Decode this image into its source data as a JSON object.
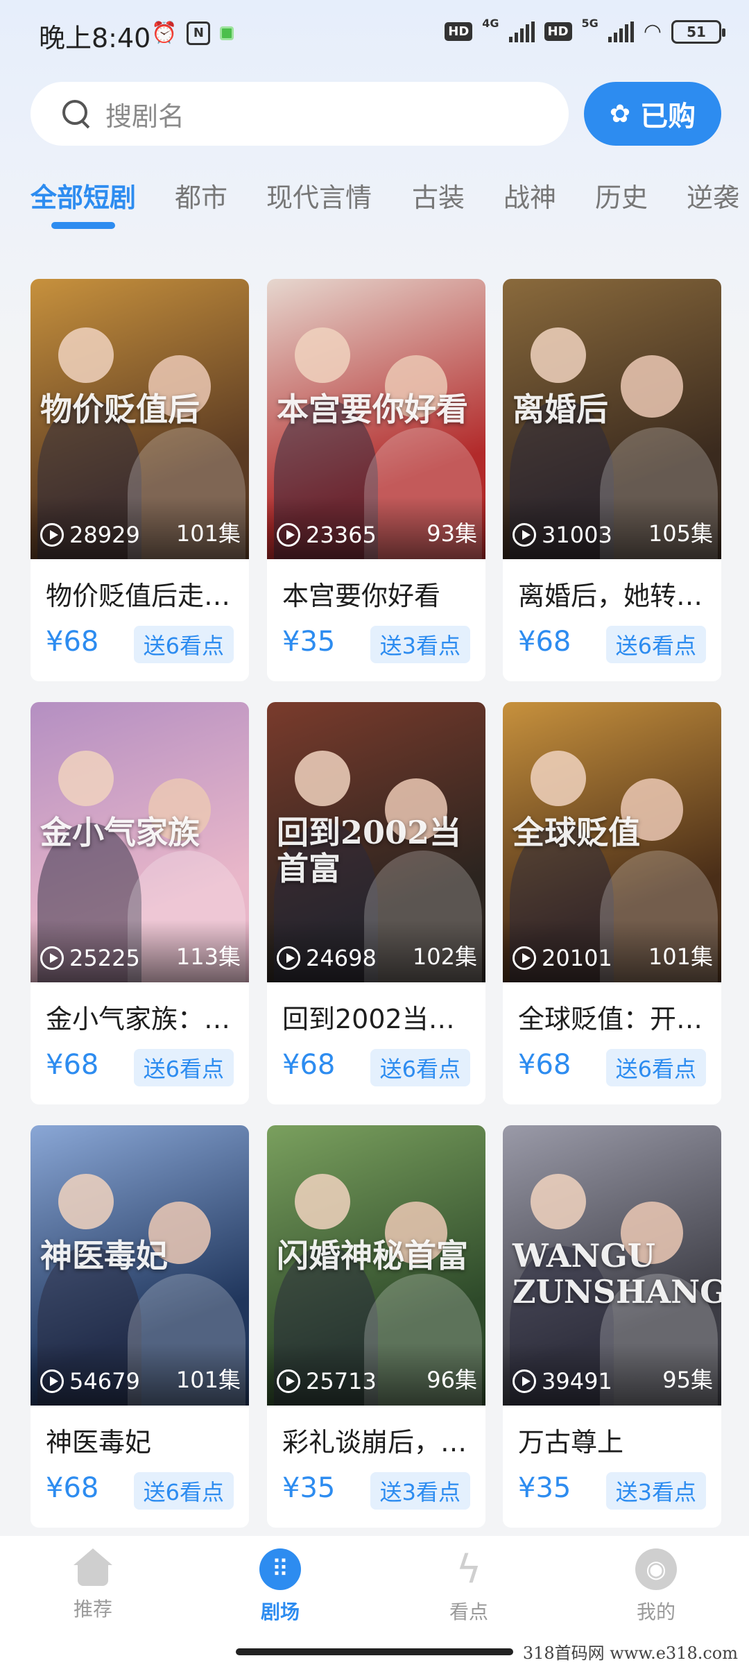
{
  "status_bar": {
    "time": "晚上8:40",
    "battery": "51",
    "net1": "4G",
    "net2": "5G",
    "hd": "HD"
  },
  "search": {
    "placeholder": "搜剧名"
  },
  "bought_button": {
    "label": "已购"
  },
  "tabs": [
    "全部短剧",
    "都市",
    "现代言情",
    "古装",
    "战神",
    "历史",
    "逆袭"
  ],
  "active_tab": 0,
  "dramas": [
    {
      "title": "物价贬值后走…",
      "plays": "28929",
      "episodes": "101集",
      "price": "¥68",
      "gift": "送6看点",
      "poster_text": "物价贬值后",
      "bg1": "#5a3a22",
      "bg2": "#c7913d"
    },
    {
      "title": "本宫要你好看",
      "plays": "23365",
      "episodes": "93集",
      "price": "¥35",
      "gift": "送3看点",
      "poster_text": "本宫要你好看",
      "bg1": "#b22a2a",
      "bg2": "#e6d7cf"
    },
    {
      "title": "离婚后，她转…",
      "plays": "31003",
      "episodes": "105集",
      "price": "¥68",
      "gift": "送6看点",
      "poster_text": "离婚后",
      "bg1": "#3a2a1e",
      "bg2": "#8a6a3c"
    },
    {
      "title": "金小气家族：…",
      "plays": "25225",
      "episodes": "113集",
      "price": "¥68",
      "gift": "送6看点",
      "poster_text": "金小气家族",
      "bg1": "#e9b7c9",
      "bg2": "#b48fc2"
    },
    {
      "title": "回到2002当…",
      "plays": "24698",
      "episodes": "102集",
      "price": "¥68",
      "gift": "送6看点",
      "poster_text": "回到2002当首富",
      "bg1": "#2b241f",
      "bg2": "#7a3b2c"
    },
    {
      "title": "全球贬值：开…",
      "plays": "20101",
      "episodes": "101集",
      "price": "¥68",
      "gift": "送6看点",
      "poster_text": "全球贬值",
      "bg1": "#4a2e18",
      "bg2": "#c7913d"
    },
    {
      "title": "神医毒妃",
      "plays": "54679",
      "episodes": "101集",
      "price": "¥68",
      "gift": "送6看点",
      "poster_text": "神医毒妃",
      "bg1": "#20365c",
      "bg2": "#8aa7d6"
    },
    {
      "title": "彩礼谈崩后，…",
      "plays": "25713",
      "episodes": "96集",
      "price": "¥35",
      "gift": "送3看点",
      "poster_text": "闪婚神秘首富",
      "bg1": "#2e4a2a",
      "bg2": "#7aa05e"
    },
    {
      "title": "万古尊上",
      "plays": "39491",
      "episodes": "95集",
      "price": "¥35",
      "gift": "送3看点",
      "poster_text": "WANGU ZUNSHANG",
      "bg1": "#3c3c44",
      "bg2": "#9a9aa8"
    }
  ],
  "bottom_nav": [
    {
      "label": "推荐",
      "icon": "home-icon"
    },
    {
      "label": "剧场",
      "icon": "theater-icon"
    },
    {
      "label": "看点",
      "icon": "lightning-icon"
    },
    {
      "label": "我的",
      "icon": "profile-icon"
    }
  ],
  "active_nav": 1,
  "watermark": "318首码网 www.e318.com"
}
